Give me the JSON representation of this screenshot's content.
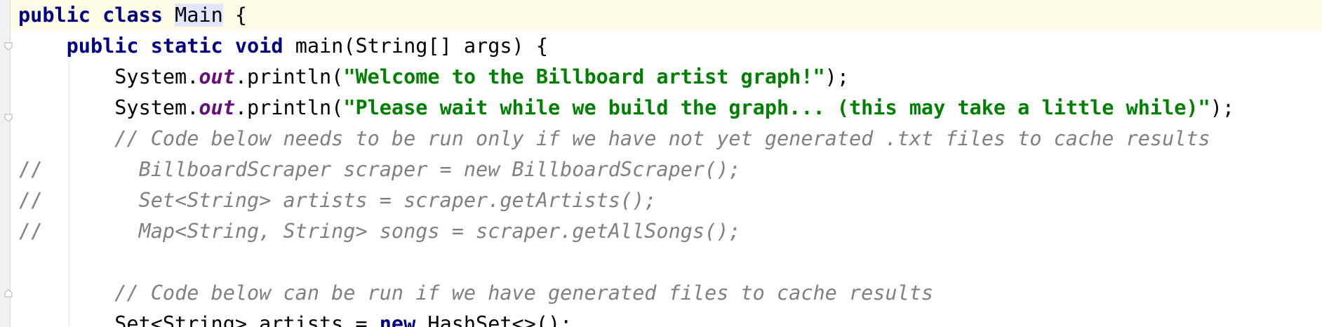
{
  "editor": {
    "lines": [
      {
        "tokens": [
          {
            "t": "public",
            "c": "kw"
          },
          {
            "t": " ",
            "c": "plain"
          },
          {
            "t": "class",
            "c": "kw"
          },
          {
            "t": " ",
            "c": "plain"
          },
          {
            "t": "Main",
            "c": "hl-id"
          },
          {
            "t": " {",
            "c": "plain"
          }
        ]
      },
      {
        "tokens": [
          {
            "t": "    ",
            "c": "plain"
          },
          {
            "t": "public",
            "c": "kw"
          },
          {
            "t": " ",
            "c": "plain"
          },
          {
            "t": "static",
            "c": "kw"
          },
          {
            "t": " ",
            "c": "plain"
          },
          {
            "t": "void",
            "c": "kw"
          },
          {
            "t": " main(String[] args) {",
            "c": "plain"
          }
        ]
      },
      {
        "tokens": [
          {
            "t": "        System.",
            "c": "plain"
          },
          {
            "t": "out",
            "c": "fld"
          },
          {
            "t": ".println(",
            "c": "plain"
          },
          {
            "t": "\"Welcome to the Billboard artist graph!\"",
            "c": "str"
          },
          {
            "t": ");",
            "c": "plain"
          }
        ]
      },
      {
        "tokens": [
          {
            "t": "        System.",
            "c": "plain"
          },
          {
            "t": "out",
            "c": "fld"
          },
          {
            "t": ".println(",
            "c": "plain"
          },
          {
            "t": "\"Please wait while we build the graph... (this may take a little while)\"",
            "c": "str"
          },
          {
            "t": ");",
            "c": "plain"
          }
        ]
      },
      {
        "tokens": [
          {
            "t": "        ",
            "c": "plain"
          },
          {
            "t": "// Code below needs to be run only if we have not yet generated .txt files to cache results",
            "c": "cmt"
          }
        ]
      },
      {
        "tokens": [
          {
            "t": "//",
            "c": "cmt-upright"
          },
          {
            "t": "        BillboardScraper scraper = new BillboardScraper();",
            "c": "cmt"
          }
        ]
      },
      {
        "tokens": [
          {
            "t": "//",
            "c": "cmt-upright"
          },
          {
            "t": "        Set<String> artists = scraper.getArtists();",
            "c": "cmt"
          }
        ]
      },
      {
        "tokens": [
          {
            "t": "//",
            "c": "cmt-upright"
          },
          {
            "t": "        Map<String, String> songs = scraper.getAllSongs();",
            "c": "cmt"
          }
        ]
      },
      {
        "tokens": []
      },
      {
        "tokens": [
          {
            "t": "        ",
            "c": "plain"
          },
          {
            "t": "// Code below can be run if we have generated files to cache results",
            "c": "cmt"
          }
        ]
      },
      {
        "tokens": [
          {
            "t": "        Set<String> artists = ",
            "c": "plain"
          },
          {
            "t": "new",
            "c": "kw"
          },
          {
            "t": " HashSet<>();",
            "c": "plain"
          }
        ]
      }
    ]
  },
  "gutter": {
    "fold_icons": [
      "fold-open-icon",
      "fold-open-icon",
      "fold-close-icon"
    ]
  },
  "colors": {
    "keyword": "#000080",
    "string": "#008000",
    "field": "#660e7a",
    "comment": "#808080",
    "current_line": "#fdfce6",
    "identifier_highlight": "#e4e4ff"
  }
}
